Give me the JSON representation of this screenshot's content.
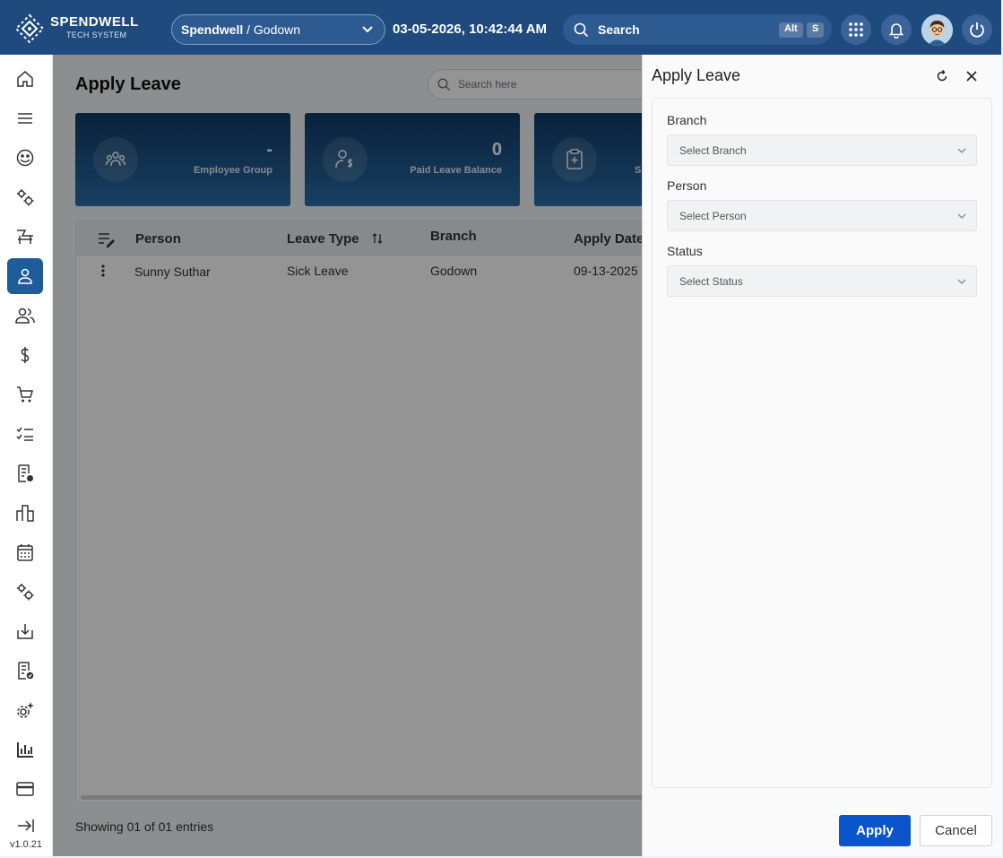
{
  "header": {
    "logo_title": "SPENDWELL",
    "logo_subtitle": "TECH SYSTEM",
    "branch_company": "Spendwell",
    "branch_separator": " / ",
    "branch_name": "Godown",
    "datetime": "03-05-2026, 10:42:44 AM",
    "search_label": "Search",
    "shortcut_key1": "Alt",
    "shortcut_key2": "S"
  },
  "sidebar": {
    "version": "v1.0.21",
    "items": [
      {
        "icon": "home-icon"
      },
      {
        "icon": "menu-icon"
      },
      {
        "icon": "face-icon"
      },
      {
        "icon": "cogs-icon"
      },
      {
        "icon": "chair-icon"
      },
      {
        "icon": "person-icon",
        "active": true
      },
      {
        "icon": "users-icon"
      },
      {
        "icon": "dollar-icon"
      },
      {
        "icon": "cart-icon"
      },
      {
        "icon": "checklist-icon"
      },
      {
        "icon": "document-icon"
      },
      {
        "icon": "buildings-icon"
      },
      {
        "icon": "calendar-icon"
      },
      {
        "icon": "cogs-icon"
      },
      {
        "icon": "download-icon"
      },
      {
        "icon": "document-check-icon"
      },
      {
        "icon": "gear-sparkle-icon"
      },
      {
        "icon": "bar-chart-icon"
      },
      {
        "icon": "card-icon"
      },
      {
        "icon": "collapse-arrow-icon"
      }
    ]
  },
  "main": {
    "title": "Apply Leave",
    "search_placeholder": "Search here",
    "cards": [
      {
        "value": "-",
        "label": "Employee Group",
        "icon": "group-icon"
      },
      {
        "value": "0",
        "label": "Paid Leave Balance",
        "icon": "person-dollar-icon"
      },
      {
        "value": "",
        "label": "S",
        "icon": "clipboard-icon"
      }
    ],
    "table": {
      "columns": [
        "Person",
        "Leave Type",
        "Branch",
        "Apply Date"
      ],
      "rows": [
        {
          "person": "Sunny Suthar",
          "leave_type": "Sick Leave",
          "branch": "Godown",
          "apply_date": "09-13-2025"
        }
      ]
    },
    "entries_text": "Showing 01 of 01 entries"
  },
  "drawer": {
    "title": "Apply Leave",
    "fields": [
      {
        "label": "Branch",
        "placeholder": "Select Branch"
      },
      {
        "label": "Person",
        "placeholder": "Select Person"
      },
      {
        "label": "Status",
        "placeholder": "Select Status"
      }
    ],
    "apply_label": "Apply",
    "cancel_label": "Cancel"
  },
  "colors": {
    "header_bg": "#1e4a7d",
    "active_nav": "#1e5d9a",
    "primary_button": "#0a55cc"
  }
}
